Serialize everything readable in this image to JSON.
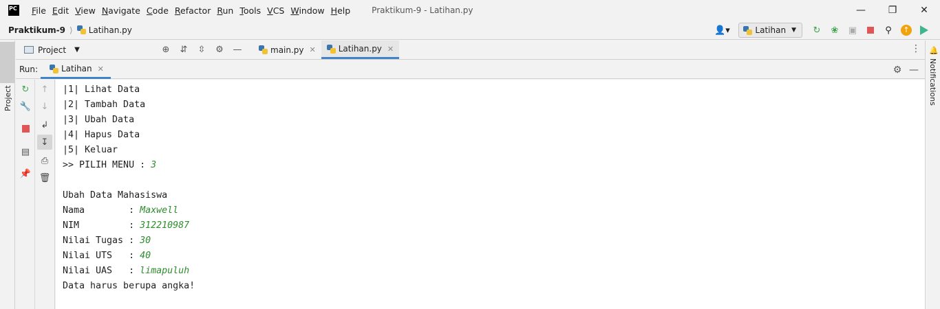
{
  "menu": {
    "items": [
      {
        "u": "F",
        "rest": "ile"
      },
      {
        "u": "E",
        "rest": "dit"
      },
      {
        "u": "V",
        "rest": "iew"
      },
      {
        "u": "N",
        "rest": "avigate"
      },
      {
        "u": "C",
        "rest": "ode"
      },
      {
        "u": "R",
        "rest": "efactor"
      },
      {
        "u": "R",
        "rest": "un"
      },
      {
        "u": "T",
        "rest": "ools"
      },
      {
        "u": "V",
        "rest": "CS"
      },
      {
        "u": "W",
        "rest": "indow"
      },
      {
        "u": "H",
        "rest": "elp"
      }
    ],
    "window_title": "Praktikum-9 - Latihan.py",
    "logo_text": "PC"
  },
  "navbar": {
    "project": "Praktikum-9",
    "file": "Latihan.py",
    "run_config": "Latihan"
  },
  "project_panel": {
    "title": "Project"
  },
  "editor_tabs": [
    {
      "label": "main.py"
    },
    {
      "label": "Latihan.py"
    }
  ],
  "run_window": {
    "label": "Run:",
    "tab": "Latihan"
  },
  "stripes": {
    "left": "Project",
    "right": "Notifications"
  },
  "console": {
    "lines": [
      {
        "text": "|1| Lihat Data",
        "input": ""
      },
      {
        "text": "|2| Tambah Data",
        "input": ""
      },
      {
        "text": "|3| Ubah Data",
        "input": ""
      },
      {
        "text": "|4| Hapus Data",
        "input": ""
      },
      {
        "text": "|5| Keluar",
        "input": ""
      },
      {
        "text": ">> PILIH MENU : ",
        "input": "3"
      },
      {
        "text": "",
        "input": ""
      },
      {
        "text": "Ubah Data Mahasiswa",
        "input": ""
      },
      {
        "text": "Nama        : ",
        "input": "Maxwell"
      },
      {
        "text": "NIM         : ",
        "input": "312210987"
      },
      {
        "text": "Nilai Tugas : ",
        "input": "30"
      },
      {
        "text": "Nilai UTS   : ",
        "input": "40"
      },
      {
        "text": "Nilai UAS   : ",
        "input": "limapuluh"
      },
      {
        "text": "Data harus berupa angka!",
        "input": ""
      }
    ]
  },
  "colors": {
    "accent": "#4083c9",
    "user_input": "#2e8b2e",
    "stop": "#e05555",
    "rerun": "#3ea44c"
  }
}
